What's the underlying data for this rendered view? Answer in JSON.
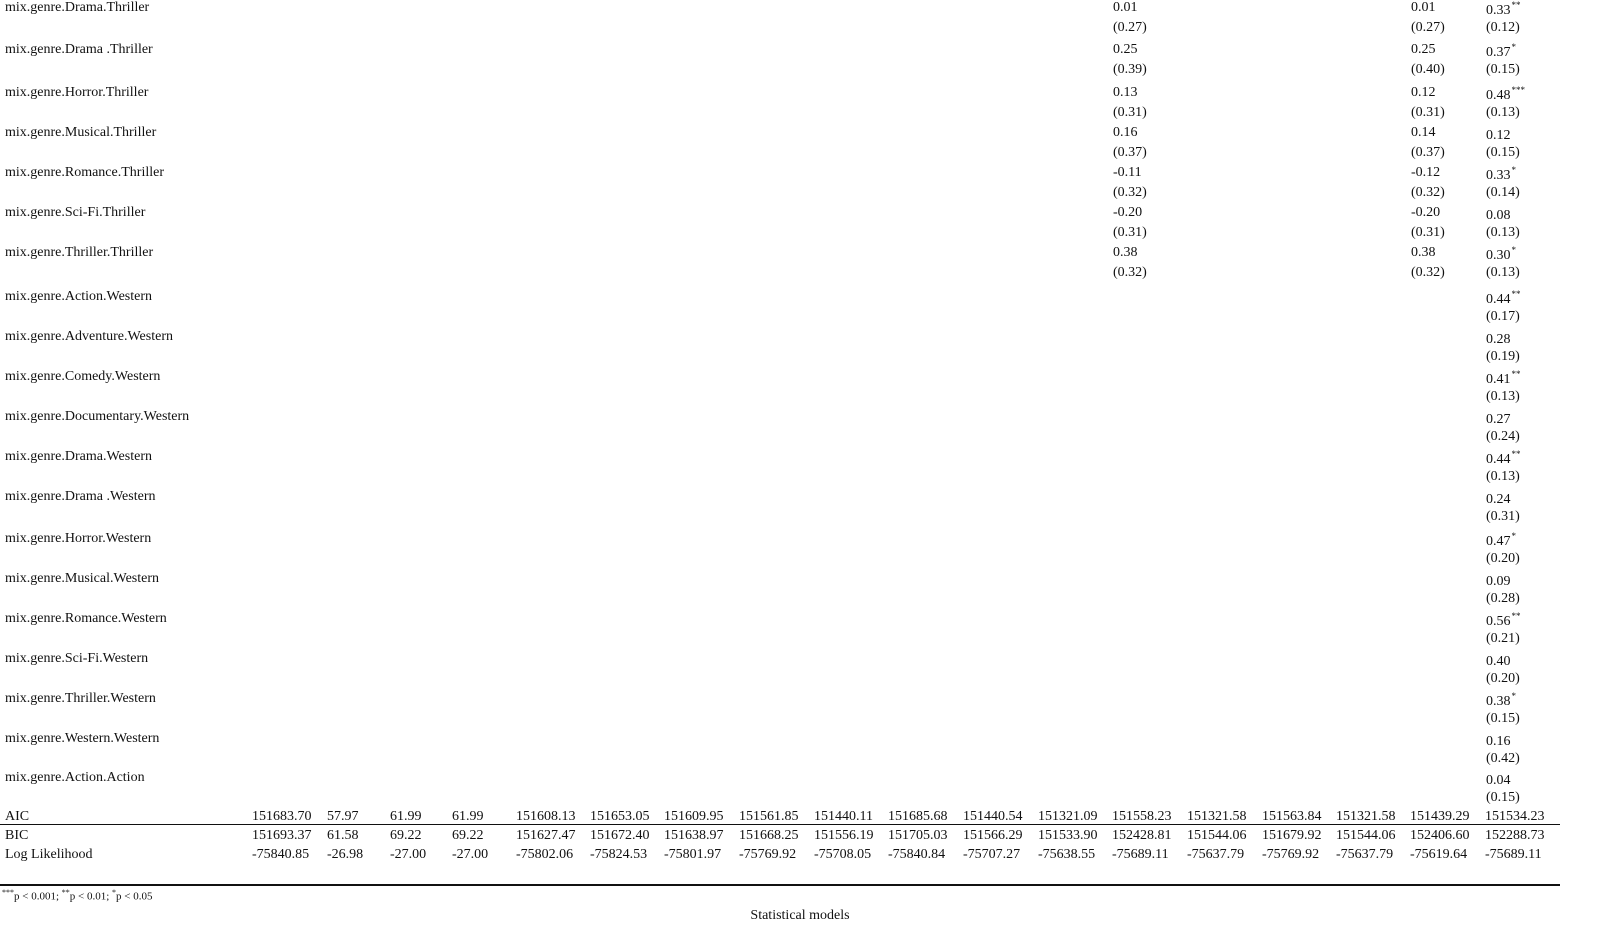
{
  "rows": [
    {
      "label": "mix.genre.Drama.Thriller",
      "m14": {
        "coef": "0.01",
        "se": "(0.27)"
      },
      "m18": {
        "coef": "0.01",
        "se": "(0.27)"
      },
      "m19": {
        "coef": "0.33",
        "stars": "**",
        "se": "(0.12)"
      }
    },
    {
      "label": "mix.genre.Drama .Thriller",
      "m14": {
        "coef": "0.25",
        "se": "(0.39)"
      },
      "m18": {
        "coef": "0.25",
        "se": "(0.40)"
      },
      "m19": {
        "coef": "0.37",
        "stars": "*",
        "se": "(0.15)"
      }
    },
    {
      "label": "mix.genre.Horror.Thriller",
      "m14": {
        "coef": "0.13",
        "se": "(0.31)"
      },
      "m18": {
        "coef": "0.12",
        "se": "(0.31)"
      },
      "m19": {
        "coef": "0.48",
        "stars": "***",
        "se": "(0.13)"
      }
    },
    {
      "label": "mix.genre.Musical.Thriller",
      "m14": {
        "coef": "0.16",
        "se": "(0.37)"
      },
      "m18": {
        "coef": "0.14",
        "se": "(0.37)"
      },
      "m19": {
        "coef": "0.12",
        "stars": "",
        "se": "(0.15)"
      }
    },
    {
      "label": "mix.genre.Romance.Thriller",
      "m14": {
        "coef": "-0.11",
        "se": "(0.32)"
      },
      "m18": {
        "coef": "-0.12",
        "se": "(0.32)"
      },
      "m19": {
        "coef": "0.33",
        "stars": "*",
        "se": "(0.14)"
      }
    },
    {
      "label": "mix.genre.Sci-Fi.Thriller",
      "m14": {
        "coef": "-0.20",
        "se": "(0.31)"
      },
      "m18": {
        "coef": "-0.20",
        "se": "(0.31)"
      },
      "m19": {
        "coef": "0.08",
        "stars": "",
        "se": "(0.13)"
      }
    },
    {
      "label": "mix.genre.Thriller.Thriller",
      "m14": {
        "coef": "0.38",
        "se": "(0.32)"
      },
      "m18": {
        "coef": "0.38",
        "se": "(0.32)"
      },
      "m19": {
        "coef": "0.30",
        "stars": "*",
        "se": "(0.13)"
      }
    },
    {
      "label": "mix.genre.Action.Western",
      "m19": {
        "coef": "0.44",
        "stars": "**",
        "se": "(0.17)"
      }
    },
    {
      "label": "mix.genre.Adventure.Western",
      "m19": {
        "coef": "0.28",
        "stars": "",
        "se": "(0.19)"
      }
    },
    {
      "label": "mix.genre.Comedy.Western",
      "m19": {
        "coef": "0.41",
        "stars": "**",
        "se": "(0.13)"
      }
    },
    {
      "label": "mix.genre.Documentary.Western",
      "m19": {
        "coef": "0.27",
        "stars": "",
        "se": "(0.24)"
      }
    },
    {
      "label": "mix.genre.Drama.Western",
      "m19": {
        "coef": "0.44",
        "stars": "**",
        "se": "(0.13)"
      }
    },
    {
      "label": "mix.genre.Drama .Western",
      "m19": {
        "coef": "0.24",
        "stars": "",
        "se": "(0.31)"
      }
    },
    {
      "label": "mix.genre.Horror.Western",
      "m19": {
        "coef": "0.47",
        "stars": "*",
        "se": "(0.20)"
      }
    },
    {
      "label": "mix.genre.Musical.Western",
      "m19": {
        "coef": "0.09",
        "stars": "",
        "se": "(0.28)"
      }
    },
    {
      "label": "mix.genre.Romance.Western",
      "m19": {
        "coef": "0.56",
        "stars": "**",
        "se": "(0.21)"
      }
    },
    {
      "label": "mix.genre.Sci-Fi.Western",
      "m19": {
        "coef": "0.40",
        "stars": "",
        "se": "(0.20)"
      }
    },
    {
      "label": "mix.genre.Thriller.Western",
      "m19": {
        "coef": "0.38",
        "stars": "*",
        "se": "(0.15)"
      }
    },
    {
      "label": "mix.genre.Western.Western",
      "m19": {
        "coef": "0.16",
        "stars": "",
        "se": "(0.42)"
      }
    },
    {
      "label": "mix.genre.Action.Action",
      "m19": {
        "coef": "0.04",
        "stars": "",
        "se": "(0.15)"
      }
    }
  ],
  "stats": [
    {
      "label": "AIC",
      "values": [
        "151683.70",
        "57.97",
        "61.99",
        "61.99",
        "151608.13",
        "151653.05",
        "151609.95",
        "151561.85",
        "151440.11",
        "151685.68",
        "151440.54",
        "151321.09",
        "151558.23",
        "151321.58",
        "151563.84",
        "151321.58",
        "151439.29",
        "151534.23"
      ]
    },
    {
      "label": "BIC",
      "values": [
        "151693.37",
        "61.58",
        "69.22",
        "69.22",
        "151627.47",
        "151672.40",
        "151638.97",
        "151668.25",
        "151556.19",
        "151705.03",
        "151566.29",
        "151533.90",
        "152428.81",
        "151544.06",
        "151679.92",
        "151544.06",
        "152406.60",
        "152288.73"
      ]
    },
    {
      "label": "Log Likelihood",
      "values": [
        "-75840.85",
        "-26.98",
        "-27.00",
        "-27.00",
        "-75802.06",
        "-75824.53",
        "-75801.97",
        "-75769.92",
        "-75708.05",
        "-75840.84",
        "-75707.27",
        "-75638.55",
        "-75689.11",
        "-75637.79",
        "-75769.92",
        "-75637.79",
        "-75619.64",
        "-75689.11"
      ]
    }
  ],
  "footnote": {
    "s3": "***",
    "t3": "p < 0.001; ",
    "s2": "**",
    "t2": "p < 0.01; ",
    "s1": "*",
    "t1": "p < 0.05"
  },
  "caption": "Statistical models"
}
